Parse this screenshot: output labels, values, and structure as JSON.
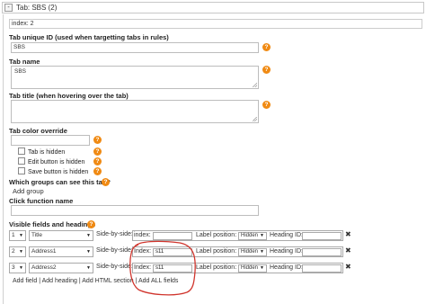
{
  "tab": {
    "title": "Tab: SBS (2)",
    "toggle_label": "-"
  },
  "index_value": "index: 2",
  "unique_id": {
    "label": "Tab unique ID (used when targetting tabs in rules)",
    "value": "SBS"
  },
  "tab_name": {
    "label": "Tab name",
    "value": "SBS"
  },
  "tab_title": {
    "label": "Tab title (when hovering over the tab)",
    "value": ""
  },
  "color": {
    "label": "Tab color override",
    "value": ""
  },
  "checkboxes": [
    {
      "label": "Tab is hidden"
    },
    {
      "label": "Edit button is hidden"
    },
    {
      "label": "Save button is hidden"
    }
  ],
  "groups": {
    "label": "Which groups can see this tab?",
    "link": "Add group"
  },
  "click_function": {
    "label": "Click function name",
    "value": ""
  },
  "visible": {
    "label": "Visible fields and headings",
    "rows": [
      {
        "num": "1",
        "field": "Title",
        "sbs": "Side-by-side:",
        "index_label": "index:",
        "index_value": "",
        "pos_label": "Label position:",
        "pos_value": "Hidden",
        "heading_label": "Heading ID:",
        "heading_value": ""
      },
      {
        "num": "2",
        "field": "Address1",
        "sbs": "Side-by-side:",
        "index_label": "Index:",
        "index_value": "s11",
        "pos_label": "Label position:",
        "pos_value": "Hidden",
        "heading_label": "Heading ID:",
        "heading_value": ""
      },
      {
        "num": "3",
        "field": "Address2",
        "sbs": "Side-by-side:",
        "index_label": "Index:",
        "index_value": "s11",
        "pos_label": "Label position:",
        "pos_value": "Hidden",
        "heading_label": "Heading ID:",
        "heading_value": ""
      }
    ]
  },
  "links": {
    "add_field": "Add field",
    "add_heading": "Add heading",
    "add_html": "Add HTML section",
    "add_all": "Add ALL fields",
    "sep": "|"
  },
  "icons": {
    "help": "help-icon",
    "delete": "delete-icon",
    "dropdown": "chevron-down-icon",
    "resize": "resize-grip-icon"
  },
  "colors": {
    "help": "#f08a13",
    "annotation": "#d0342c"
  }
}
